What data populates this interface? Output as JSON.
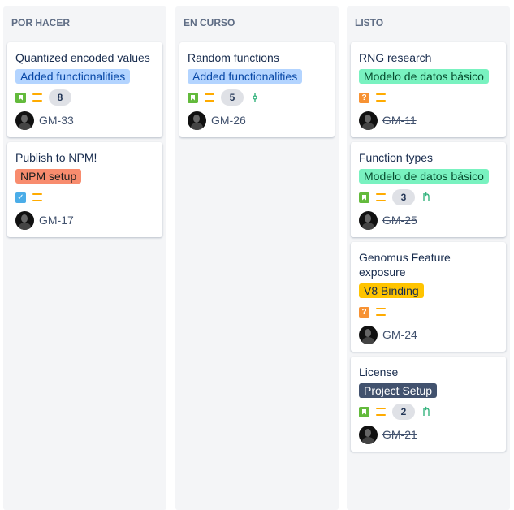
{
  "columns": [
    {
      "title": "POR HACER",
      "cards": [
        {
          "title": "Quantized encoded values",
          "epic": "Added functionalities",
          "type": "story",
          "points": "8",
          "dev": "",
          "key": "GM-33",
          "done": false
        },
        {
          "title": "Publish to NPM!",
          "epic": "NPM setup",
          "type": "task",
          "points": "",
          "dev": "",
          "key": "GM-17",
          "done": false
        }
      ]
    },
    {
      "title": "EN CURSO",
      "cards": [
        {
          "title": "Random functions",
          "epic": "Added functionalities",
          "type": "story",
          "points": "5",
          "dev": "commit",
          "key": "GM-26",
          "done": false
        }
      ]
    },
    {
      "title": "LISTO",
      "cards": [
        {
          "title": "RNG research",
          "epic": "Modelo de datos básico",
          "type": "spike",
          "points": "",
          "dev": "",
          "key": "GM-11",
          "done": true
        },
        {
          "title": "Function types",
          "epic": "Modelo de datos básico",
          "type": "story",
          "points": "3",
          "dev": "pull-request",
          "key": "GM-25",
          "done": true
        },
        {
          "title": "Genomus Feature exposure",
          "epic": "V8 Binding",
          "type": "spike",
          "points": "",
          "dev": "",
          "key": "GM-24",
          "done": true
        },
        {
          "title": "License",
          "epic": "Project Setup",
          "type": "story",
          "points": "2",
          "dev": "pull-request",
          "key": "GM-21",
          "done": true
        }
      ]
    }
  ],
  "epic_colors": {
    "Added functionalities": {
      "bg": "#b3d4ff",
      "fg": "#0747a6"
    },
    "NPM setup": {
      "bg": "#f88c6e",
      "fg": "#1e1e1e"
    },
    "Modelo de datos básico": {
      "bg": "#79f2c0",
      "fg": "#064d2e"
    },
    "V8 Binding": {
      "bg": "#ffc400",
      "fg": "#172b4d"
    },
    "Project Setup": {
      "bg": "#42526e",
      "fg": "#ffffff"
    }
  },
  "icons": {
    "story": "story-icon",
    "task": "task-icon",
    "spike": "spike-icon",
    "priority": "priority-medium-icon",
    "commit": "commit-icon",
    "pull-request": "pull-request-icon",
    "avatar": "avatar"
  },
  "priority_color": "#ffab00",
  "dev_color": "#36b37e"
}
